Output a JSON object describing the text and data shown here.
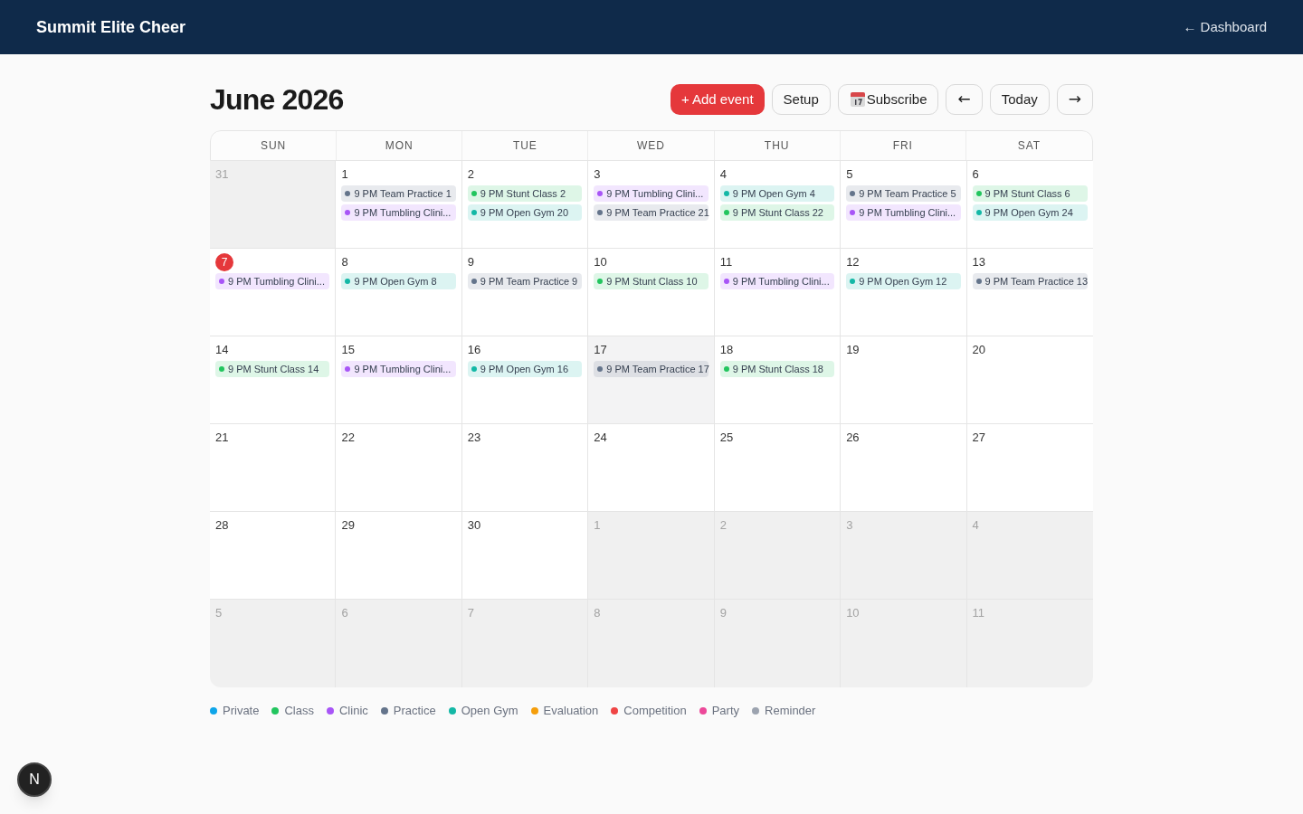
{
  "header": {
    "title": "Summit Elite Cheer",
    "back_link": "← Dashboard"
  },
  "toolbar": {
    "month_title": "June 2026",
    "buttons": [
      {
        "kind": "primary",
        "label": "+ Add event"
      },
      {
        "kind": "outline",
        "label": "Setup"
      },
      {
        "kind": "outline_calendar",
        "label": "Subscribe"
      },
      {
        "kind": "outline_arrow",
        "label": "←"
      },
      {
        "kind": "outline",
        "label": "Today"
      },
      {
        "kind": "outline_arrow",
        "label": "→"
      }
    ]
  },
  "calendar": {
    "weekdays": [
      "SUN",
      "MON",
      "TUE",
      "WED",
      "THU",
      "FRI",
      "SAT"
    ],
    "weeks": [
      {
        "days": [
          {
            "day": "31",
            "in_month": false,
            "today": false,
            "selected": false
          },
          {
            "day": "1",
            "in_month": true,
            "today": false,
            "selected": false,
            "events": [
              {
                "label": "9 PM Team Practice 1",
                "color": "#64748b"
              },
              {
                "label": "9 PM Tumbling Clini...",
                "color": "#a855f7"
              }
            ]
          },
          {
            "day": "2",
            "in_month": true,
            "today": false,
            "selected": false,
            "events": [
              {
                "label": "9 PM Stunt Class 2",
                "color": "#22c55e"
              },
              {
                "label": "9 PM Open Gym 20",
                "color": "#14b8a6"
              }
            ]
          },
          {
            "day": "3",
            "in_month": true,
            "today": false,
            "selected": false,
            "events": [
              {
                "label": "9 PM Tumbling Clini...",
                "color": "#a855f7"
              },
              {
                "label": "9 PM Team Practice 21",
                "color": "#64748b"
              }
            ]
          },
          {
            "day": "4",
            "in_month": true,
            "today": false,
            "selected": false,
            "events": [
              {
                "label": "9 PM Open Gym 4",
                "color": "#14b8a6"
              },
              {
                "label": "9 PM Stunt Class 22",
                "color": "#22c55e"
              }
            ]
          },
          {
            "day": "5",
            "in_month": true,
            "today": false,
            "selected": false,
            "events": [
              {
                "label": "9 PM Team Practice 5",
                "color": "#64748b"
              },
              {
                "label": "9 PM Tumbling Clini...",
                "color": "#a855f7"
              }
            ]
          },
          {
            "day": "6",
            "in_month": true,
            "today": false,
            "selected": false,
            "events": [
              {
                "label": "9 PM Stunt Class 6",
                "color": "#22c55e"
              },
              {
                "label": "9 PM Open Gym 24",
                "color": "#14b8a6"
              }
            ]
          }
        ]
      },
      {
        "days": [
          {
            "day": "7",
            "in_month": true,
            "today": true,
            "selected": false,
            "events": [
              {
                "label": "9 PM Tumbling Clini...",
                "color": "#a855f7"
              }
            ]
          },
          {
            "day": "8",
            "in_month": true,
            "today": false,
            "selected": false,
            "events": [
              {
                "label": "9 PM Open Gym 8",
                "color": "#14b8a6"
              }
            ]
          },
          {
            "day": "9",
            "in_month": true,
            "today": false,
            "selected": false,
            "events": [
              {
                "label": "9 PM Team Practice 9",
                "color": "#64748b"
              }
            ]
          },
          {
            "day": "10",
            "in_month": true,
            "today": false,
            "selected": false,
            "events": [
              {
                "label": "9 PM Stunt Class 10",
                "color": "#22c55e"
              }
            ]
          },
          {
            "day": "11",
            "in_month": true,
            "today": false,
            "selected": false,
            "events": [
              {
                "label": "9 PM Tumbling Clini...",
                "color": "#a855f7"
              }
            ]
          },
          {
            "day": "12",
            "in_month": true,
            "today": false,
            "selected": false,
            "events": [
              {
                "label": "9 PM Open Gym 12",
                "color": "#14b8a6"
              }
            ]
          },
          {
            "day": "13",
            "in_month": true,
            "today": false,
            "selected": false,
            "events": [
              {
                "label": "9 PM Team Practice 13",
                "color": "#64748b"
              }
            ]
          }
        ]
      },
      {
        "days": [
          {
            "day": "14",
            "in_month": true,
            "today": false,
            "selected": false,
            "events": [
              {
                "label": "9 PM Stunt Class 14",
                "color": "#22c55e"
              }
            ]
          },
          {
            "day": "15",
            "in_month": true,
            "today": false,
            "selected": false,
            "events": [
              {
                "label": "9 PM Tumbling Clini...",
                "color": "#a855f7"
              }
            ]
          },
          {
            "day": "16",
            "in_month": true,
            "today": false,
            "selected": false,
            "events": [
              {
                "label": "9 PM Open Gym 16",
                "color": "#14b8a6"
              }
            ]
          },
          {
            "day": "17",
            "in_month": true,
            "today": false,
            "selected": true,
            "events": [
              {
                "label": "9 PM Team Practice 17",
                "color": "#64748b"
              }
            ]
          },
          {
            "day": "18",
            "in_month": true,
            "today": false,
            "selected": false,
            "events": [
              {
                "label": "9 PM Stunt Class 18",
                "color": "#22c55e"
              }
            ]
          },
          {
            "day": "19",
            "in_month": true,
            "today": false,
            "selected": false
          },
          {
            "day": "20",
            "in_month": true,
            "today": false,
            "selected": false
          }
        ]
      },
      {
        "days": [
          {
            "day": "21",
            "in_month": true,
            "today": false,
            "selected": false
          },
          {
            "day": "22",
            "in_month": true,
            "today": false,
            "selected": false
          },
          {
            "day": "23",
            "in_month": true,
            "today": false,
            "selected": false
          },
          {
            "day": "24",
            "in_month": true,
            "today": false,
            "selected": false
          },
          {
            "day": "25",
            "in_month": true,
            "today": false,
            "selected": false
          },
          {
            "day": "26",
            "in_month": true,
            "today": false,
            "selected": false
          },
          {
            "day": "27",
            "in_month": true,
            "today": false,
            "selected": false
          }
        ]
      },
      {
        "days": [
          {
            "day": "28",
            "in_month": true,
            "today": false,
            "selected": false
          },
          {
            "day": "29",
            "in_month": true,
            "today": false,
            "selected": false
          },
          {
            "day": "30",
            "in_month": true,
            "today": false,
            "selected": false
          },
          {
            "day": "1",
            "in_month": false,
            "today": false,
            "selected": false
          },
          {
            "day": "2",
            "in_month": false,
            "today": false,
            "selected": false
          },
          {
            "day": "3",
            "in_month": false,
            "today": false,
            "selected": false
          },
          {
            "day": "4",
            "in_month": false,
            "today": false,
            "selected": false
          }
        ]
      },
      {
        "days": [
          {
            "day": "5",
            "in_month": false,
            "today": false,
            "selected": false
          },
          {
            "day": "6",
            "in_month": false,
            "today": false,
            "selected": false
          },
          {
            "day": "7",
            "in_month": false,
            "today": false,
            "selected": false
          },
          {
            "day": "8",
            "in_month": false,
            "today": false,
            "selected": false
          },
          {
            "day": "9",
            "in_month": false,
            "today": false,
            "selected": false
          },
          {
            "day": "10",
            "in_month": false,
            "today": false,
            "selected": false
          },
          {
            "day": "11",
            "in_month": false,
            "today": false,
            "selected": false
          }
        ]
      }
    ]
  },
  "legend": [
    {
      "label": "Private",
      "color": "#0ea5e9"
    },
    {
      "label": "Class",
      "color": "#22c55e"
    },
    {
      "label": "Clinic",
      "color": "#a855f7"
    },
    {
      "label": "Practice",
      "color": "#64748b"
    },
    {
      "label": "Open Gym",
      "color": "#14b8a6"
    },
    {
      "label": "Evaluation",
      "color": "#f59e0b"
    },
    {
      "label": "Competition",
      "color": "#ef4444"
    },
    {
      "label": "Party",
      "color": "#ec4899"
    },
    {
      "label": "Reminder",
      "color": "#9ca3af"
    }
  ],
  "dev_badge": {
    "label": "N"
  }
}
